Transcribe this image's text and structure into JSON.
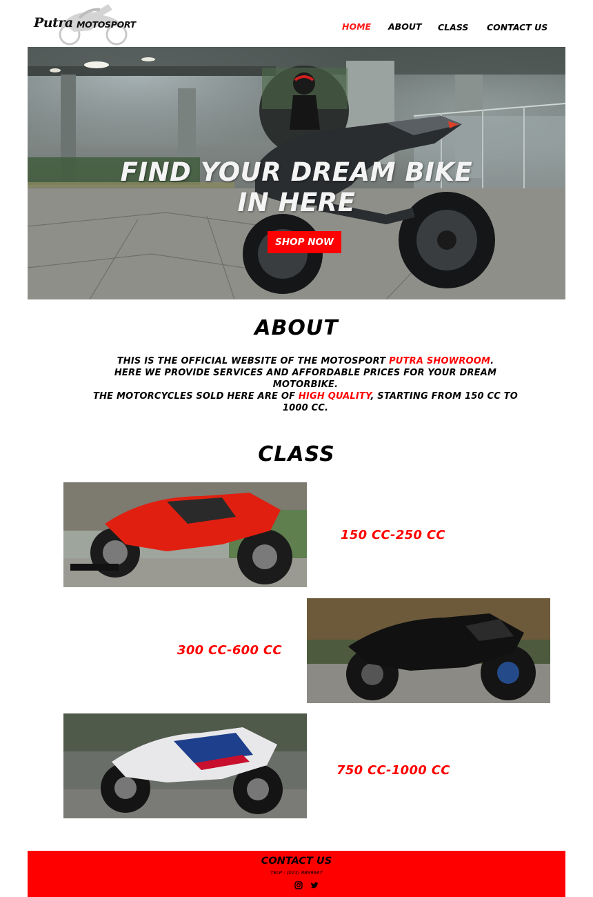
{
  "brand": {
    "script": "Putra",
    "word": "MOTOSPORT"
  },
  "nav": {
    "items": [
      {
        "label": "HOME",
        "active": true
      },
      {
        "label": "ABOUT",
        "active": false
      },
      {
        "label": "CLASS",
        "active": false
      },
      {
        "label": "CONTACT US",
        "active": false
      }
    ]
  },
  "hero": {
    "title_line1": "FIND YOUR DREAM BIKE",
    "title_line2": "IN HERE",
    "button_label": "SHOP NOW"
  },
  "about": {
    "title": "ABOUT",
    "p1_before": "THIS IS THE OFFICIAL WEBSITE OF THE MOTOSPORT ",
    "p1_highlight": "PUTRA SHOWROOM",
    "p1_after": ".",
    "p2": "HERE WE PROVIDE SERVICES AND AFFORDABLE PRICES FOR YOUR DREAM MOTORBIKE.",
    "p3_before": "THE MOTORCYCLES SOLD HERE ARE OF ",
    "p3_highlight": "HIGH QUALITY",
    "p3_after": ", STARTING FROM 150 CC TO 1000 CC."
  },
  "classes": {
    "title": "CLASS",
    "items": [
      {
        "label": "150 CC-250 CC"
      },
      {
        "label": "300 CC-600 CC"
      },
      {
        "label": "750 CC-1000 CC"
      }
    ]
  },
  "footer": {
    "title": "CONTACT US",
    "phone": "TELP : (021) 8899667",
    "social": [
      "instagram-icon",
      "twitter-icon"
    ]
  },
  "colors": {
    "accent": "#ff0000",
    "text": "#000000",
    "background": "#ffffff"
  }
}
